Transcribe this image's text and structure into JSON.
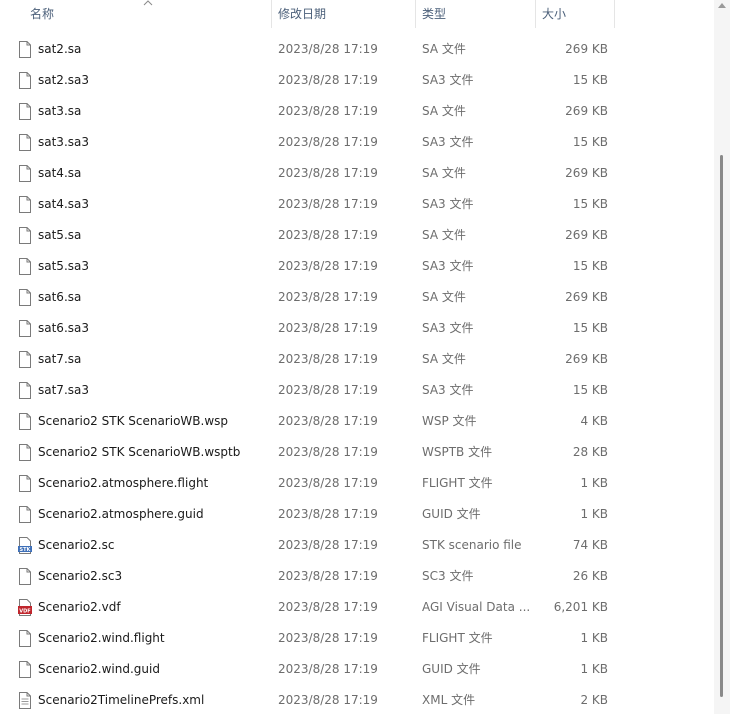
{
  "columns": {
    "name": "名称",
    "modified": "修改日期",
    "type": "类型",
    "size": "大小"
  },
  "files": [
    {
      "name": "sat2.sa",
      "modified": "2023/8/28 17:19",
      "type": "SA 文件",
      "size": "269 KB",
      "icon": "generic-file-icon"
    },
    {
      "name": "sat2.sa3",
      "modified": "2023/8/28 17:19",
      "type": "SA3 文件",
      "size": "15 KB",
      "icon": "generic-file-icon"
    },
    {
      "name": "sat3.sa",
      "modified": "2023/8/28 17:19",
      "type": "SA 文件",
      "size": "269 KB",
      "icon": "generic-file-icon"
    },
    {
      "name": "sat3.sa3",
      "modified": "2023/8/28 17:19",
      "type": "SA3 文件",
      "size": "15 KB",
      "icon": "generic-file-icon"
    },
    {
      "name": "sat4.sa",
      "modified": "2023/8/28 17:19",
      "type": "SA 文件",
      "size": "269 KB",
      "icon": "generic-file-icon"
    },
    {
      "name": "sat4.sa3",
      "modified": "2023/8/28 17:19",
      "type": "SA3 文件",
      "size": "15 KB",
      "icon": "generic-file-icon"
    },
    {
      "name": "sat5.sa",
      "modified": "2023/8/28 17:19",
      "type": "SA 文件",
      "size": "269 KB",
      "icon": "generic-file-icon"
    },
    {
      "name": "sat5.sa3",
      "modified": "2023/8/28 17:19",
      "type": "SA3 文件",
      "size": "15 KB",
      "icon": "generic-file-icon"
    },
    {
      "name": "sat6.sa",
      "modified": "2023/8/28 17:19",
      "type": "SA 文件",
      "size": "269 KB",
      "icon": "generic-file-icon"
    },
    {
      "name": "sat6.sa3",
      "modified": "2023/8/28 17:19",
      "type": "SA3 文件",
      "size": "15 KB",
      "icon": "generic-file-icon"
    },
    {
      "name": "sat7.sa",
      "modified": "2023/8/28 17:19",
      "type": "SA 文件",
      "size": "269 KB",
      "icon": "generic-file-icon"
    },
    {
      "name": "sat7.sa3",
      "modified": "2023/8/28 17:19",
      "type": "SA3 文件",
      "size": "15 KB",
      "icon": "generic-file-icon"
    },
    {
      "name": "Scenario2 STK ScenarioWB.wsp",
      "modified": "2023/8/28 17:19",
      "type": "WSP 文件",
      "size": "4 KB",
      "icon": "generic-file-icon"
    },
    {
      "name": "Scenario2 STK ScenarioWB.wsptb",
      "modified": "2023/8/28 17:19",
      "type": "WSPTB 文件",
      "size": "28 KB",
      "icon": "generic-file-icon"
    },
    {
      "name": "Scenario2.atmosphere.flight",
      "modified": "2023/8/28 17:19",
      "type": "FLIGHT 文件",
      "size": "1 KB",
      "icon": "generic-file-icon"
    },
    {
      "name": "Scenario2.atmosphere.guid",
      "modified": "2023/8/28 17:19",
      "type": "GUID 文件",
      "size": "1 KB",
      "icon": "generic-file-icon"
    },
    {
      "name": "Scenario2.sc",
      "modified": "2023/8/28 17:19",
      "type": "STK scenario file",
      "size": "74 KB",
      "icon": "stk-scenario-icon"
    },
    {
      "name": "Scenario2.sc3",
      "modified": "2023/8/28 17:19",
      "type": "SC3 文件",
      "size": "26 KB",
      "icon": "generic-file-icon"
    },
    {
      "name": "Scenario2.vdf",
      "modified": "2023/8/28 17:19",
      "type": "AGI Visual Data ...",
      "size": "6,201 KB",
      "icon": "vdf-file-icon"
    },
    {
      "name": "Scenario2.wind.flight",
      "modified": "2023/8/28 17:19",
      "type": "FLIGHT 文件",
      "size": "1 KB",
      "icon": "generic-file-icon"
    },
    {
      "name": "Scenario2.wind.guid",
      "modified": "2023/8/28 17:19",
      "type": "GUID 文件",
      "size": "1 KB",
      "icon": "generic-file-icon"
    },
    {
      "name": "Scenario2TimelinePrefs.xml",
      "modified": "2023/8/28 17:19",
      "type": "XML 文件",
      "size": "2 KB",
      "icon": "xml-file-icon"
    }
  ],
  "icon_labels": {
    "stk": "STK",
    "vdf": "VDF"
  },
  "colors": {
    "header_text": "#4c607a",
    "row_text": "#1a1a1a",
    "meta_text": "#6d6d6d",
    "stk_icon": "#3d6fb8",
    "vdf_icon": "#c0262d"
  }
}
